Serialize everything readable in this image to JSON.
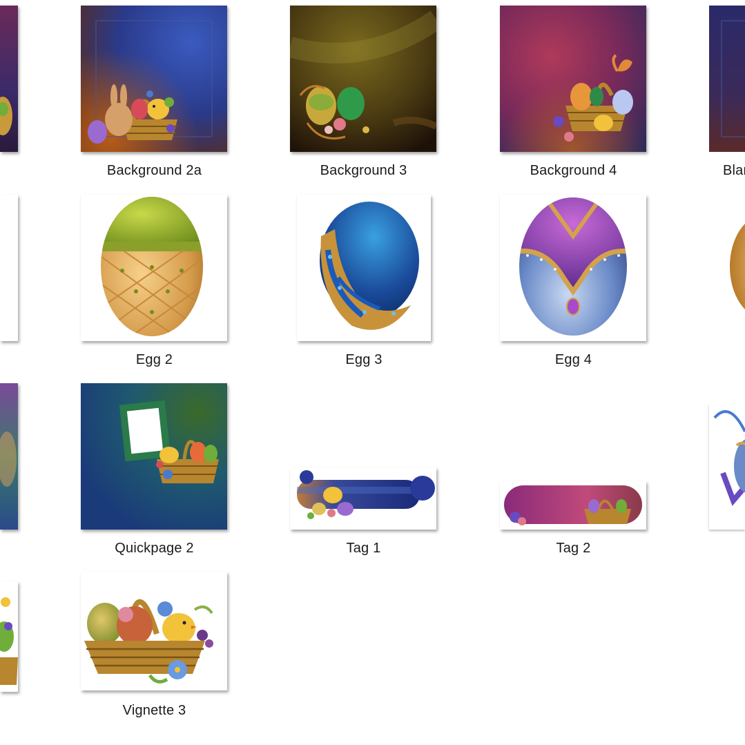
{
  "view": "explorer-large-icons",
  "files": [
    {
      "id": "background-2a",
      "name": "Background 2a",
      "thumbnail": "background-basket-bunny-chick-icon"
    },
    {
      "id": "background-3",
      "name": "Background 3",
      "thumbnail": "background-eggs-flowers-icon"
    },
    {
      "id": "background-4",
      "name": "Background 4",
      "thumbnail": "background-basket-butterfly-icon"
    },
    {
      "id": "blank-partial",
      "name": "Blan",
      "thumbnail": "background-dark-icon"
    },
    {
      "id": "egg-2",
      "name": "Egg 2",
      "thumbnail": "gold-egg-icon"
    },
    {
      "id": "egg-3",
      "name": "Egg 3",
      "thumbnail": "blue-filigree-egg-icon"
    },
    {
      "id": "egg-4",
      "name": "Egg 4",
      "thumbnail": "purple-jeweled-egg-icon"
    },
    {
      "id": "quickpage-2",
      "name": "Quickpage 2",
      "thumbnail": "quickpage-frame-basket-icon"
    },
    {
      "id": "tag-1",
      "name": "Tag 1",
      "thumbnail": "blue-tag-chick-icon"
    },
    {
      "id": "tag-2",
      "name": "Tag 2",
      "thumbnail": "purple-tag-basket-icon"
    },
    {
      "id": "vignette-3",
      "name": "Vignette 3",
      "thumbnail": "basket-chick-vignette-icon"
    }
  ],
  "colors": {
    "background": "#ffffff",
    "label_text": "#1a1a1a",
    "blue_bg": "#2a3f8a",
    "gold": "#d4a24a",
    "purple": "#8a3f9a",
    "teal": "#1f5a6e"
  }
}
